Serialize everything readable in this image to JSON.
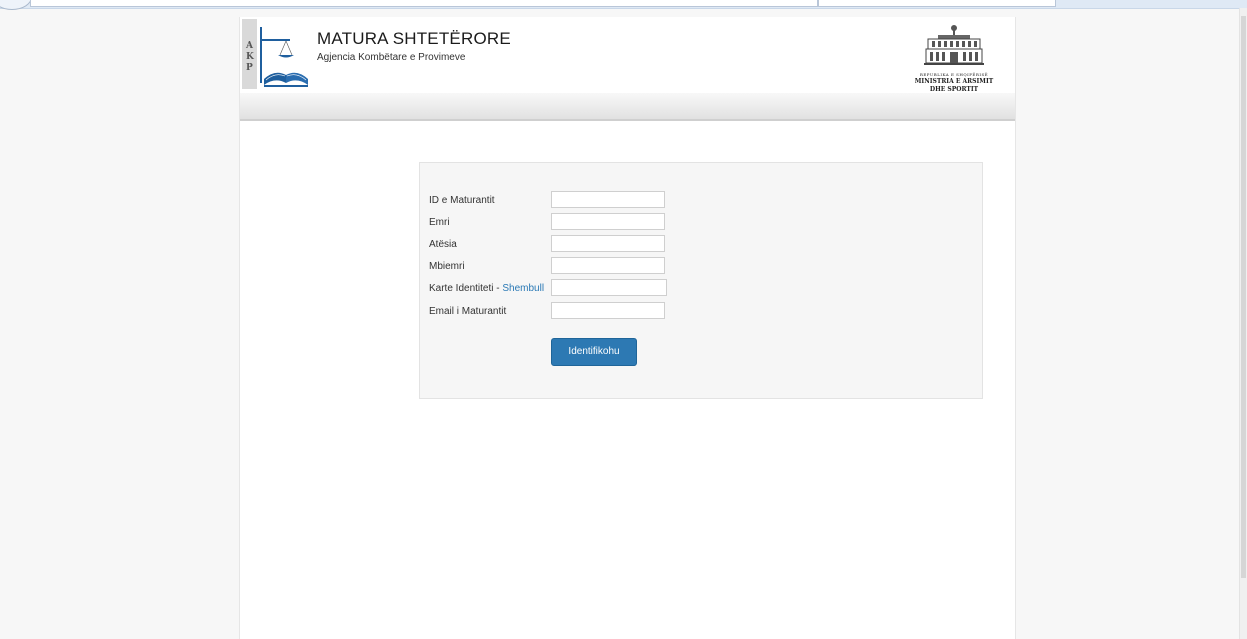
{
  "header": {
    "title": "MATURA SHTETËRORE",
    "subtitle": "Agjencia Kombëtare e Provimeve",
    "logo_letters": [
      "A",
      "K",
      "P"
    ],
    "ministry_lines": [
      "REPUBLIKA E SHQIPËRISË",
      "MINISTRIA E ARSIMIT",
      "DHE SPORTIT"
    ]
  },
  "form": {
    "fields": [
      {
        "label": "ID e Maturantit",
        "value": ""
      },
      {
        "label": "Emri",
        "value": ""
      },
      {
        "label": "Atësia",
        "value": ""
      },
      {
        "label": "Mbiemri",
        "value": ""
      },
      {
        "label": "Karte Identiteti - ",
        "link": "Shembull",
        "value": ""
      },
      {
        "label": "Email i Maturantit",
        "value": ""
      }
    ],
    "submit_label": "Identifikohu"
  },
  "colors": {
    "accent": "#2d79b3",
    "link": "#2a79b5",
    "logo_blue": "#1f5f9e"
  }
}
